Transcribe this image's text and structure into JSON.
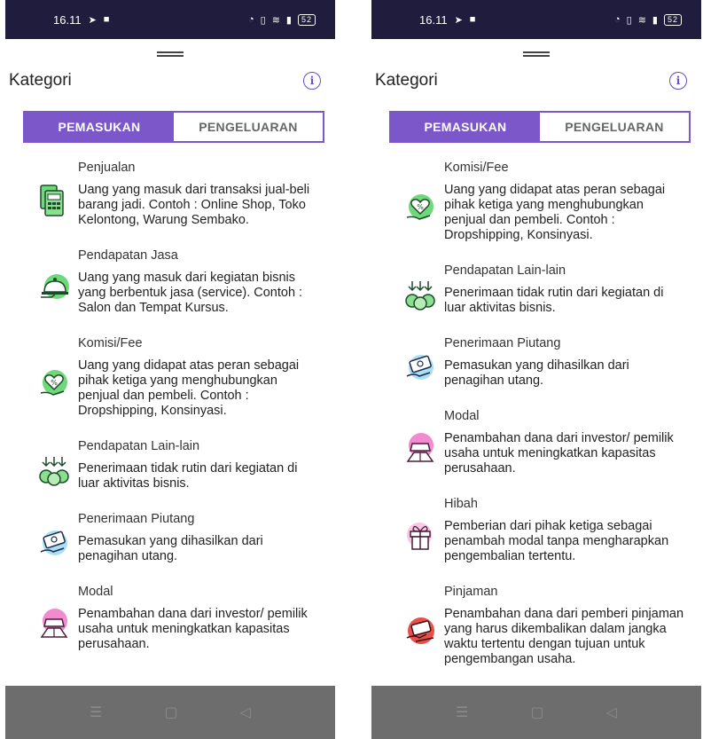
{
  "status_bar": {
    "time": "16.11",
    "battery": "52"
  },
  "header": {
    "title": "Kategori"
  },
  "tabs": {
    "income": "PEMASUKAN",
    "expense": "PENGELUARAN"
  },
  "left_list": [
    {
      "name": "Penjualan",
      "desc": "Uang yang masuk dari transaksi jual-beli barang jadi. Contoh : Online Shop, Toko Kelontong, Warung Sembako.",
      "icon": "shop-icon"
    },
    {
      "name": "Pendapatan Jasa",
      "desc": "Uang yang masuk dari kegiatan bisnis yang berbentuk jasa (service). Contoh : Salon dan Tempat Kursus.",
      "icon": "service-icon"
    },
    {
      "name": "Komisi/Fee",
      "desc": "Uang yang didapat atas peran sebagai pihak ketiga yang menghubungkan penjual dan pembeli. Contoh : Dropshipping, Konsinyasi.",
      "icon": "commission-icon"
    },
    {
      "name": "Pendapatan Lain-lain",
      "desc": "Penerimaan tidak rutin dari kegiatan di luar aktivitas bisnis.",
      "icon": "coins-icon"
    },
    {
      "name": "Penerimaan Piutang",
      "desc": "Pemasukan yang dihasilkan dari penagihan utang.",
      "icon": "receivable-icon"
    },
    {
      "name": "Modal",
      "desc": "Penambahan dana dari investor/ pemilik usaha untuk meningkatkan kapasitas perusahaan.",
      "icon": "capital-icon"
    }
  ],
  "right_list": [
    {
      "name": "Komisi/Fee",
      "desc": "Uang yang didapat atas peran sebagai pihak ketiga yang menghubungkan penjual dan pembeli. Contoh : Dropshipping, Konsinyasi.",
      "icon": "commission-icon"
    },
    {
      "name": "Pendapatan Lain-lain",
      "desc": "Penerimaan tidak rutin dari kegiatan di luar aktivitas bisnis.",
      "icon": "coins-icon"
    },
    {
      "name": "Penerimaan Piutang",
      "desc": "Pemasukan yang dihasilkan dari penagihan utang.",
      "icon": "receivable-icon"
    },
    {
      "name": "Modal",
      "desc": "Penambahan dana dari investor/ pemilik usaha untuk meningkatkan kapasitas perusahaan.",
      "icon": "capital-icon"
    },
    {
      "name": "Hibah",
      "desc": "Pemberian dari pihak ketiga sebagai penambah modal tanpa mengharapkan pengembalian tertentu.",
      "icon": "gift-icon"
    },
    {
      "name": "Pinjaman",
      "desc": "Penambahan dana dari pemberi pinjaman yang harus dikembalikan dalam jangka waktu tertentu dengan tujuan untuk pengembangan usaha.",
      "icon": "loan-icon"
    }
  ],
  "colors": {
    "accent": "#7b57c9",
    "status_bar": "#1f1c3d",
    "nav_bar": "#6d6d6d"
  }
}
